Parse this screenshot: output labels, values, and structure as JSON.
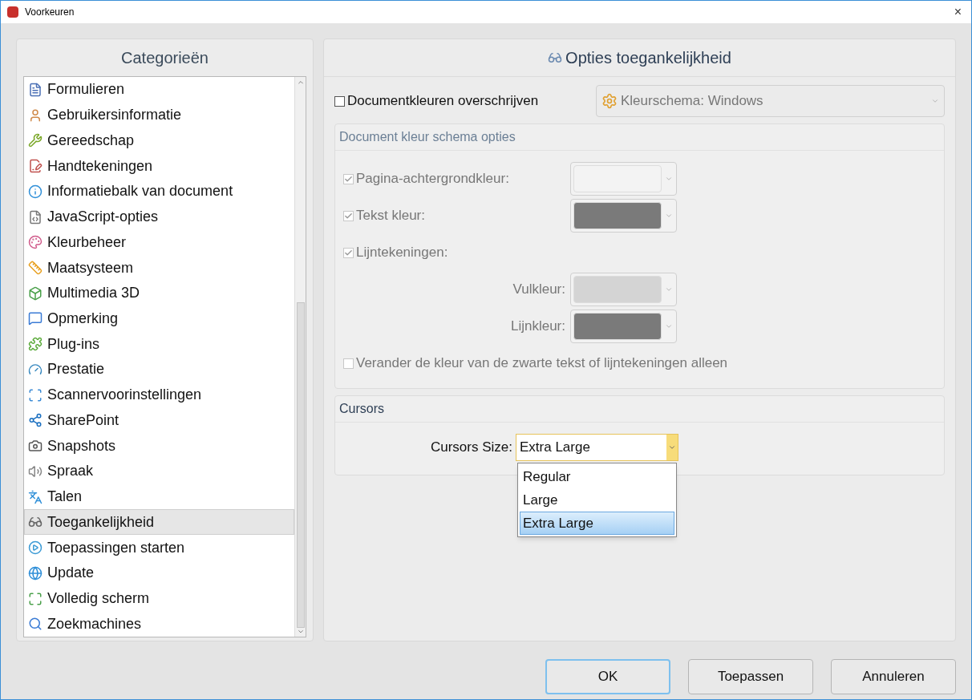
{
  "window": {
    "title": "Voorkeuren",
    "close": "×"
  },
  "categories": {
    "title": "Categorieën",
    "items": [
      {
        "label": "Formulieren",
        "selected": false
      },
      {
        "label": "Gebruikersinformatie",
        "selected": false
      },
      {
        "label": "Gereedschap",
        "selected": false
      },
      {
        "label": "Handtekeningen",
        "selected": false
      },
      {
        "label": "Informatiebalk van document",
        "selected": false
      },
      {
        "label": "JavaScript-opties",
        "selected": false
      },
      {
        "label": "Kleurbeheer",
        "selected": false
      },
      {
        "label": "Maatsysteem",
        "selected": false
      },
      {
        "label": "Multimedia 3D",
        "selected": false
      },
      {
        "label": "Opmerking",
        "selected": false
      },
      {
        "label": "Plug-ins",
        "selected": false
      },
      {
        "label": "Prestatie",
        "selected": false
      },
      {
        "label": "Scannervoorinstellingen",
        "selected": false
      },
      {
        "label": "SharePoint",
        "selected": false
      },
      {
        "label": "Snapshots",
        "selected": false
      },
      {
        "label": "Spraak",
        "selected": false
      },
      {
        "label": "Talen",
        "selected": false
      },
      {
        "label": "Toegankelijkheid",
        "selected": true
      },
      {
        "label": "Toepassingen starten",
        "selected": false
      },
      {
        "label": "Update",
        "selected": false
      },
      {
        "label": "Volledig scherm",
        "selected": false
      },
      {
        "label": "Zoekmachines",
        "selected": false
      }
    ]
  },
  "panel": {
    "title": "Opties toegankelijkheid",
    "override": {
      "label": "Documentkleuren overschrijven",
      "checked": false
    },
    "scheme_select": {
      "value": "Kleurschema: Windows",
      "disabled": true
    },
    "scheme_group": {
      "title": "Document kleur schema opties",
      "disabled": true,
      "rows": [
        {
          "kind": "check_swatch",
          "label": "Pagina-achtergrondkleur:",
          "checked": true,
          "color": "#f3f3f3"
        },
        {
          "kind": "check_swatch",
          "label": "Tekst kleur:",
          "checked": true,
          "color": "#7a7a7a"
        },
        {
          "kind": "check",
          "label": "Lijntekeningen:",
          "checked": true
        },
        {
          "kind": "swatch",
          "label": "Vulkleur:",
          "color": "#d4d4d4"
        },
        {
          "kind": "swatch",
          "label": "Lijnkleur:",
          "color": "#7a7a7a"
        },
        {
          "kind": "check",
          "label": "Verander de kleur van de zwarte tekst of lijntekeningen alleen",
          "checked": false
        }
      ]
    },
    "cursors": {
      "title": "Cursors",
      "label": "Cursors Size:",
      "value": "Extra Large",
      "expanded": true,
      "options": [
        {
          "label": "Regular",
          "selected": false
        },
        {
          "label": "Large",
          "selected": false
        },
        {
          "label": "Extra Large",
          "selected": true
        }
      ]
    }
  },
  "buttons": [
    {
      "label": "OK",
      "default": true
    },
    {
      "label": "Toepassen",
      "default": false
    },
    {
      "label": "Annuleren",
      "default": false
    }
  ]
}
